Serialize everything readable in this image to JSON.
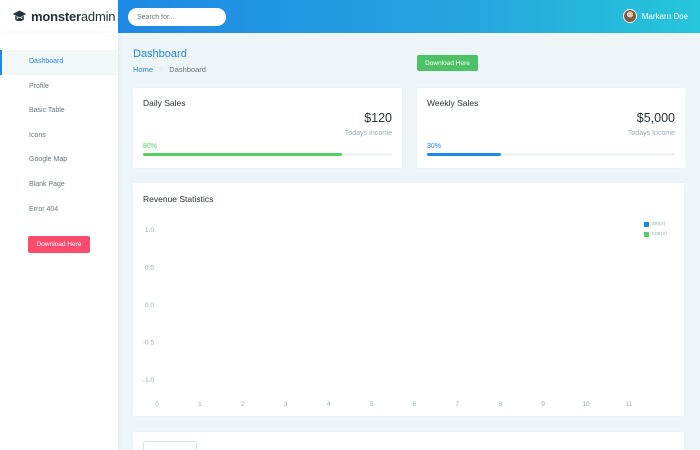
{
  "app": {
    "logo_bold": "monster",
    "logo_light": "admin"
  },
  "search": {
    "placeholder": "Search for..."
  },
  "user": {
    "name": "Markarn Doe"
  },
  "sidebar": {
    "items": [
      {
        "label": "Dashboard"
      },
      {
        "label": "Profile"
      },
      {
        "label": "Basic Table"
      },
      {
        "label": "Icons"
      },
      {
        "label": "Google Map"
      },
      {
        "label": "Blank Page"
      },
      {
        "label": "Error 404"
      }
    ],
    "download_label": "Download Here"
  },
  "page": {
    "title": "Dashboard",
    "breadcrumb": {
      "home": "Home",
      "current": "Dashboard"
    },
    "download_label": "Download Here"
  },
  "daily": {
    "title": "Daily Sales",
    "amount": "$120",
    "sub": "Todays Income",
    "percent_label": "80%",
    "percent": 80,
    "color": "#55ce63"
  },
  "weekly": {
    "title": "Weekly Sales",
    "amount": "$5,000",
    "sub": "Todays Income",
    "percent_label": "30%",
    "percent": 30,
    "color": "#1e88e5"
  },
  "revenue": {
    "title": "Revenue Statistics",
    "chart_data": {
      "type": "line",
      "title": "Revenue Statistics",
      "x": [
        0,
        1,
        2,
        3,
        4,
        5,
        6,
        7,
        8,
        9,
        10,
        11
      ],
      "y_ticks": [
        "1.0",
        "0.5",
        "0.0",
        "-0.5",
        "-1.0"
      ],
      "ylim": [
        -1.0,
        1.0
      ],
      "series": [
        {
          "name": "sin(x)",
          "color": "#1e88e5",
          "values": []
        },
        {
          "name": "cos(x)",
          "color": "#55ce63",
          "values": []
        }
      ],
      "legend": "top-right",
      "grid": false
    }
  }
}
